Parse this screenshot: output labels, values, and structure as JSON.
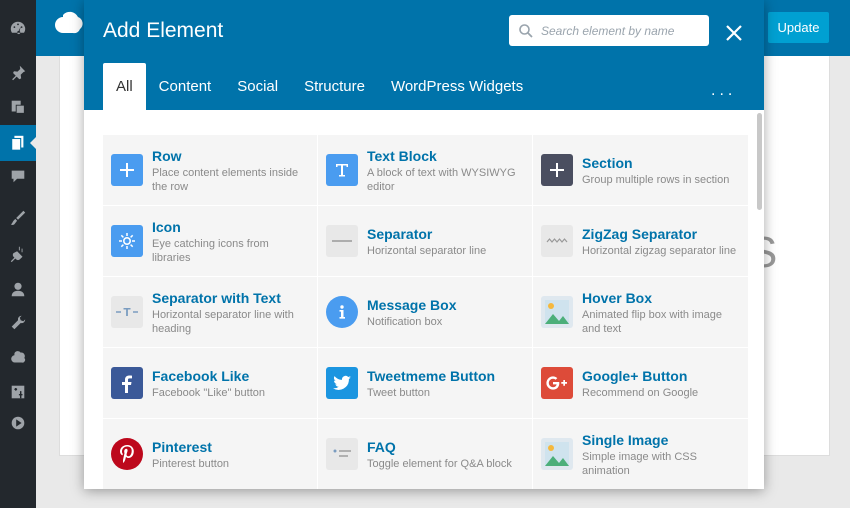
{
  "window": {
    "update_label": "Update"
  },
  "modal": {
    "title": "Add Element",
    "search_placeholder": "Search element by name",
    "more_label": "...",
    "tabs": [
      {
        "label": "All",
        "active": true
      },
      {
        "label": "Content"
      },
      {
        "label": "Social"
      },
      {
        "label": "Structure"
      },
      {
        "label": "WordPress Widgets"
      }
    ]
  },
  "elements": [
    {
      "name": "Row",
      "desc": "Place content elements inside the row",
      "icon": "plus-icon",
      "color": "#4a9cf0"
    },
    {
      "name": "Text Block",
      "desc": "A block of text with WYSIWYG editor",
      "icon": "text-t-icon",
      "color": "#4a9cf0"
    },
    {
      "name": "Section",
      "desc": "Group multiple rows in section",
      "icon": "plus-icon",
      "color": "#4a4e60"
    },
    {
      "name": "Icon",
      "desc": "Eye catching icons from libraries",
      "icon": "sun-icon",
      "color": "#4a9cf0"
    },
    {
      "name": "Separator",
      "desc": "Horizontal separator line",
      "icon": "line-icon",
      "color": "#e8e8e8"
    },
    {
      "name": "ZigZag Separator",
      "desc": "Horizontal zigzag separator line",
      "icon": "zigzag-icon",
      "color": "#e8e8e8"
    },
    {
      "name": "Separator with Text",
      "desc": "Horizontal separator line with heading",
      "icon": "separator-text-icon",
      "color": "#e8e8e8"
    },
    {
      "name": "Message Box",
      "desc": "Notification box",
      "icon": "info-icon",
      "color": "#4a9cf0"
    },
    {
      "name": "Hover Box",
      "desc": "Animated flip box with image and text",
      "icon": "image-icon",
      "color": "#dfe8ef"
    },
    {
      "name": "Facebook Like",
      "desc": "Facebook \"Like\" button",
      "icon": "facebook-icon",
      "color": "#3b5998"
    },
    {
      "name": "Tweetmeme Button",
      "desc": "Tweet button",
      "icon": "twitter-icon",
      "color": "#1b95e0"
    },
    {
      "name": "Google+ Button",
      "desc": "Recommend on Google",
      "icon": "google-plus-icon",
      "color": "#dd4b39"
    },
    {
      "name": "Pinterest",
      "desc": "Pinterest button",
      "icon": "pinterest-icon",
      "color": "#bd081c"
    },
    {
      "name": "FAQ",
      "desc": "Toggle element for Q&A block",
      "icon": "faq-icon",
      "color": "#e8e8e8"
    },
    {
      "name": "Single Image",
      "desc": "Simple image with CSS animation",
      "icon": "image-icon",
      "color": "#dfe8ef"
    }
  ],
  "background_text": "S"
}
